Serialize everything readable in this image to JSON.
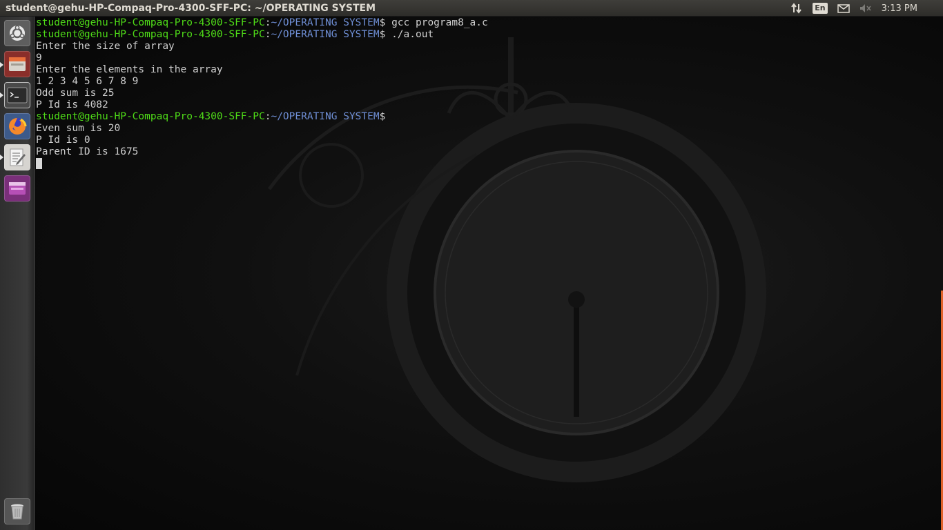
{
  "topbar": {
    "window_title": "student@gehu-HP-Compaq-Pro-4300-SFF-PC: ~/OPERATING SYSTEM",
    "keyboard_layout": "En",
    "clock": "3:13 PM",
    "icons": [
      "network-updown-icon",
      "keyboard-layout-icon",
      "mail-icon",
      "volume-muted-icon"
    ]
  },
  "launcher": {
    "items": [
      "dash-home-icon",
      "files-icon",
      "terminal-icon",
      "firefox-icon",
      "text-editor-icon",
      "software-icon",
      "trash-icon"
    ]
  },
  "terminal": {
    "prompt_user": "student@gehu-HP-Compaq-Pro-4300-SFF-PC",
    "prompt_sep": ":",
    "prompt_path": "~/OPERATING SYSTEM",
    "prompt_dollar": "$",
    "cmd1": " gcc program8_a.c",
    "cmd2": " ./a.out",
    "out": {
      "l1": "Enter the size of array",
      "l2": "9",
      "l3": "Enter the elements in the array",
      "l4": "1 2 3 4 5 6 7 8 9",
      "l5": "Odd sum is 25",
      "l6": "P Id is 4082",
      "l7": "Even sum is 20",
      "l8": "P Id is 0",
      "l9": "Parent ID is 1675"
    }
  },
  "colors": {
    "prompt_user": "#4fdc18",
    "prompt_path": "#6f8fd6",
    "output_text": "#cfcfcf",
    "topbar_bg": "#3a3935",
    "accent": "#e0622a"
  }
}
